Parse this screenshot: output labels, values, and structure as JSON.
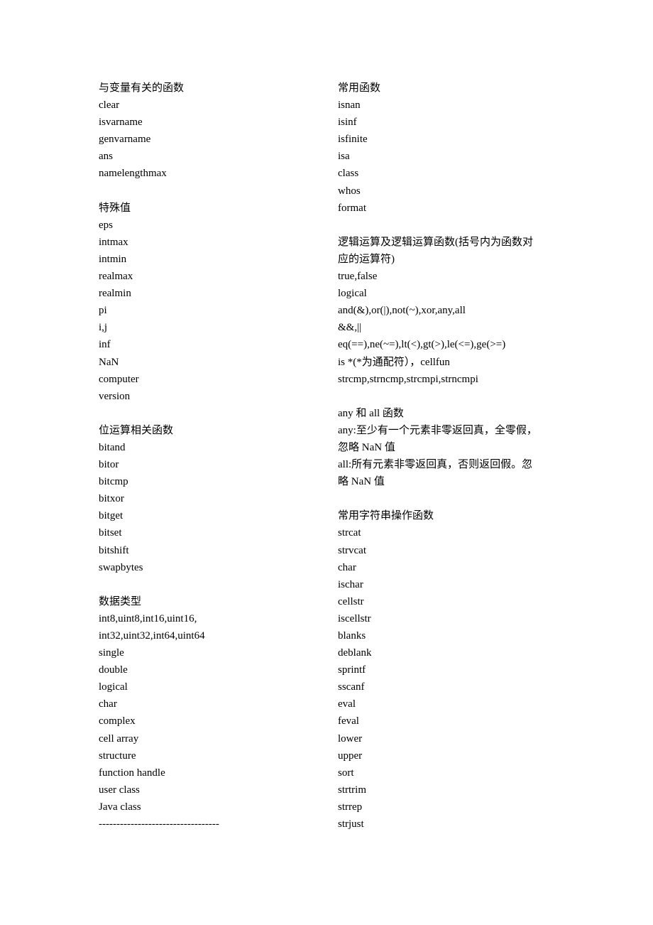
{
  "left_column": [
    {
      "type": "heading",
      "text": "与变量有关的函数"
    },
    {
      "type": "item",
      "text": "clear"
    },
    {
      "type": "item",
      "text": "isvarname"
    },
    {
      "type": "item",
      "text": "genvarname"
    },
    {
      "type": "item",
      "text": "ans"
    },
    {
      "type": "item",
      "text": "namelengthmax"
    },
    {
      "type": "blank",
      "text": ""
    },
    {
      "type": "heading",
      "text": "特殊值"
    },
    {
      "type": "item",
      "text": "eps"
    },
    {
      "type": "item",
      "text": "intmax"
    },
    {
      "type": "item",
      "text": "intmin"
    },
    {
      "type": "item",
      "text": "realmax"
    },
    {
      "type": "item",
      "text": "realmin"
    },
    {
      "type": "item",
      "text": "pi"
    },
    {
      "type": "item",
      "text": "i,j"
    },
    {
      "type": "item",
      "text": "inf"
    },
    {
      "type": "item",
      "text": "NaN"
    },
    {
      "type": "item",
      "text": "computer"
    },
    {
      "type": "item",
      "text": "version"
    },
    {
      "type": "blank",
      "text": ""
    },
    {
      "type": "heading",
      "text": "位运算相关函数"
    },
    {
      "type": "item",
      "text": "bitand"
    },
    {
      "type": "item",
      "text": "bitor"
    },
    {
      "type": "item",
      "text": "bitcmp"
    },
    {
      "type": "item",
      "text": "bitxor"
    },
    {
      "type": "item",
      "text": "bitget"
    },
    {
      "type": "item",
      "text": "bitset"
    },
    {
      "type": "item",
      "text": "bitshift"
    },
    {
      "type": "item",
      "text": "swapbytes"
    },
    {
      "type": "blank",
      "text": ""
    },
    {
      "type": "heading",
      "text": "数据类型"
    },
    {
      "type": "item",
      "text": "int8,uint8,int16,uint16,"
    },
    {
      "type": "item",
      "text": "int32,uint32,int64,uint64"
    },
    {
      "type": "item",
      "text": "single"
    },
    {
      "type": "item",
      "text": "double"
    },
    {
      "type": "item",
      "text": "logical"
    },
    {
      "type": "item",
      "text": "char"
    },
    {
      "type": "item",
      "text": "complex"
    },
    {
      "type": "item",
      "text": "cell array"
    },
    {
      "type": "item",
      "text": "structure"
    },
    {
      "type": "item",
      "text": "function handle"
    },
    {
      "type": "item",
      "text": "user class"
    },
    {
      "type": "item",
      "text": "Java class"
    },
    {
      "type": "divider",
      "text": "----------------------------------"
    }
  ],
  "right_column": [
    {
      "type": "heading",
      "text": "常用函数"
    },
    {
      "type": "item",
      "text": "isnan"
    },
    {
      "type": "item",
      "text": "isinf"
    },
    {
      "type": "item",
      "text": "isfinite"
    },
    {
      "type": "item",
      "text": "isa"
    },
    {
      "type": "item",
      "text": "class"
    },
    {
      "type": "item",
      "text": "whos"
    },
    {
      "type": "item",
      "text": "format"
    },
    {
      "type": "blank",
      "text": ""
    },
    {
      "type": "heading",
      "text": "逻辑运算及逻辑运算函数(括号内为函数对"
    },
    {
      "type": "heading",
      "text": "应的运算符)"
    },
    {
      "type": "item",
      "text": "true,false"
    },
    {
      "type": "item",
      "text": "logical"
    },
    {
      "type": "item",
      "text": "and(&),or(|),not(~),xor,any,all"
    },
    {
      "type": "item",
      "text": "&&,||"
    },
    {
      "type": "item",
      "text": "eq(==),ne(~=),lt(<),gt(>),le(<=),ge(>=)"
    },
    {
      "type": "item",
      "text": "is *(*为通配符），cellfun"
    },
    {
      "type": "item",
      "text": "strcmp,strncmp,strcmpi,strncmpi"
    },
    {
      "type": "blank",
      "text": ""
    },
    {
      "type": "heading",
      "text": "any 和 all 函数"
    },
    {
      "type": "item",
      "text": "any:至少有一个元素非零返回真，全零假，"
    },
    {
      "type": "item",
      "text": "忽略 NaN 值"
    },
    {
      "type": "item",
      "text": "all:所有元素非零返回真，否则返回假。忽"
    },
    {
      "type": "item",
      "text": "略 NaN 值"
    },
    {
      "type": "blank",
      "text": ""
    },
    {
      "type": "heading",
      "text": "常用字符串操作函数"
    },
    {
      "type": "item",
      "text": "strcat"
    },
    {
      "type": "item",
      "text": "strvcat"
    },
    {
      "type": "item",
      "text": "char"
    },
    {
      "type": "item",
      "text": "ischar"
    },
    {
      "type": "item",
      "text": "cellstr"
    },
    {
      "type": "item",
      "text": "iscellstr"
    },
    {
      "type": "item",
      "text": "blanks"
    },
    {
      "type": "item",
      "text": "deblank"
    },
    {
      "type": "item",
      "text": "sprintf"
    },
    {
      "type": "item",
      "text": "sscanf"
    },
    {
      "type": "item",
      "text": "eval"
    },
    {
      "type": "item",
      "text": "feval"
    },
    {
      "type": "item",
      "text": "lower"
    },
    {
      "type": "item",
      "text": "upper"
    },
    {
      "type": "item",
      "text": "sort"
    },
    {
      "type": "item",
      "text": "strtrim"
    },
    {
      "type": "item",
      "text": "strrep"
    },
    {
      "type": "item",
      "text": "strjust"
    }
  ]
}
